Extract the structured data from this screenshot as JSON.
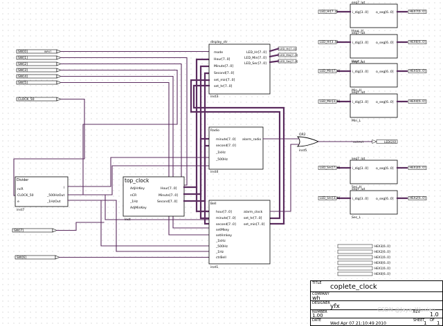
{
  "inputs": [
    "SW[0]",
    "SW[1]",
    "SW[2]",
    "SW[3]",
    "SW[4]",
    "SW[5]"
  ],
  "input_pin_label": "INPUT",
  "output_pin_label": "OUTPUT",
  "clock": "CLOCK_50",
  "sw_extra": [
    "SW[7]",
    "SW[6]"
  ],
  "divider": {
    "title": "Divider",
    "inst": "inst7",
    "ports_left": [
      "ncR",
      "CLOCK_50",
      "e"
    ],
    "ports_right": [
      "l",
      "_500HzOut",
      "_1HzOut"
    ]
  },
  "top_clock": {
    "title": "top_clock",
    "inst": "inst",
    "ports_left": [
      "AdjHrKey",
      "nCR",
      "_1Hz",
      "AdjMinKey"
    ],
    "ports_right": [
      "Hour[7..0]",
      "Minute[7..0]",
      "Second[7..0]"
    ]
  },
  "display": {
    "title": "display_ctr",
    "inst": "inst3",
    "ports_left": [
      "mode",
      "Hour[7..0]",
      "Minute[7..0]",
      "Second[7..0]",
      "set_min[7..0]",
      "set_hr[7..0]"
    ],
    "ports_right": [
      "LED_Hr[7..0]",
      "LED_Min[7..0]",
      "LED_Sec[7..0]"
    ]
  },
  "display_outputs": [
    "LED_Hr[7..0]",
    "LED_Min[7..0]",
    "LED_Sec[7..0]"
  ],
  "radio": {
    "title": "Radio",
    "inst": "inst4",
    "ports_left": [
      "minute[7..0]",
      "second[7..0]",
      "_1kHz",
      "_500Hz"
    ],
    "ports_right": [
      "alarm_radio"
    ]
  },
  "bell": {
    "title": "Bell",
    "inst": "inst1",
    "ports_left": [
      "hour[7..0]",
      "minute[7..0]",
      "second[7..0]",
      "setMkey",
      "setHmkey",
      "_1kHz",
      "_500Hz",
      "_1Hz",
      "ctrBell"
    ],
    "ports_right": [
      "alarm_clock",
      "set_hr[7..0]",
      "set_min[7..0]"
    ]
  },
  "or_gate": {
    "title": "OR2",
    "inst": "inst5"
  },
  "output_ledg": "LEDG[0]",
  "seg_blocks": [
    {
      "title": "seg7_lut",
      "in": "LED_Hr[7..4]",
      "out": "HEX7[6..0]",
      "inst": "Hour_H",
      "pl": "i_dig[3..0]",
      "pr": "o_seg[6..0]"
    },
    {
      "title": "seg7_lut",
      "in": "LED_Hr[3..0]",
      "out": "HEX6[6..0]",
      "inst": "Hour_L",
      "pl": "i_dig[3..0]",
      "pr": "o_seg[6..0]"
    },
    {
      "title": "seg7_lut",
      "in": "LED_Min[7..4]",
      "out": "HEX5[6..0]",
      "inst": "Min_H",
      "pl": "i_dig[3..0]",
      "pr": "o_seg[6..0]"
    },
    {
      "title": "seg7_lut",
      "in": "LED_Min[3..0]",
      "out": "HEX4[6..0]",
      "inst": "Min_L",
      "pl": "i_dig[3..0]",
      "pr": "o_seg[6..0]"
    },
    {
      "title": "seg7_lut",
      "in": "LED_Sec[7..4]",
      "out": "HEX3[6..0]",
      "inst": "Sec_H",
      "pl": "i_dig[3..0]",
      "pr": "o_seg[6..0]"
    },
    {
      "title": "seg7_lut",
      "in": "LED_Sec[3..0]",
      "out": "HEX2[6..0]",
      "inst": "Sec_L",
      "pl": "i_dig[3..0]",
      "pr": "o_seg[6..0]"
    }
  ],
  "hex_outputs": [
    "HEX3[6..0]",
    "HEX2[6..0]",
    "HEX1[6..0]",
    "HEX0[6..0]",
    "HEX1[6..0]",
    "HEX0[6..0]"
  ],
  "title_block": {
    "title_key": "TITLE",
    "title": "coplete_clock",
    "company_key": "COMPANY",
    "company": "wh",
    "designer_key": "DESIGNER",
    "designer": "yfx",
    "number_key": "NUMBER",
    "number": "1.00",
    "rev_key": "REV",
    "rev": "1.0",
    "date_key": "DATE",
    "date": "Wed Apr 07 21:10:49 2010",
    "sheet_key": "SHEET",
    "sheet": "1",
    "of_key": "OF",
    "of": "1"
  },
  "watermark": "CSDN @Jaya_Wuxian"
}
